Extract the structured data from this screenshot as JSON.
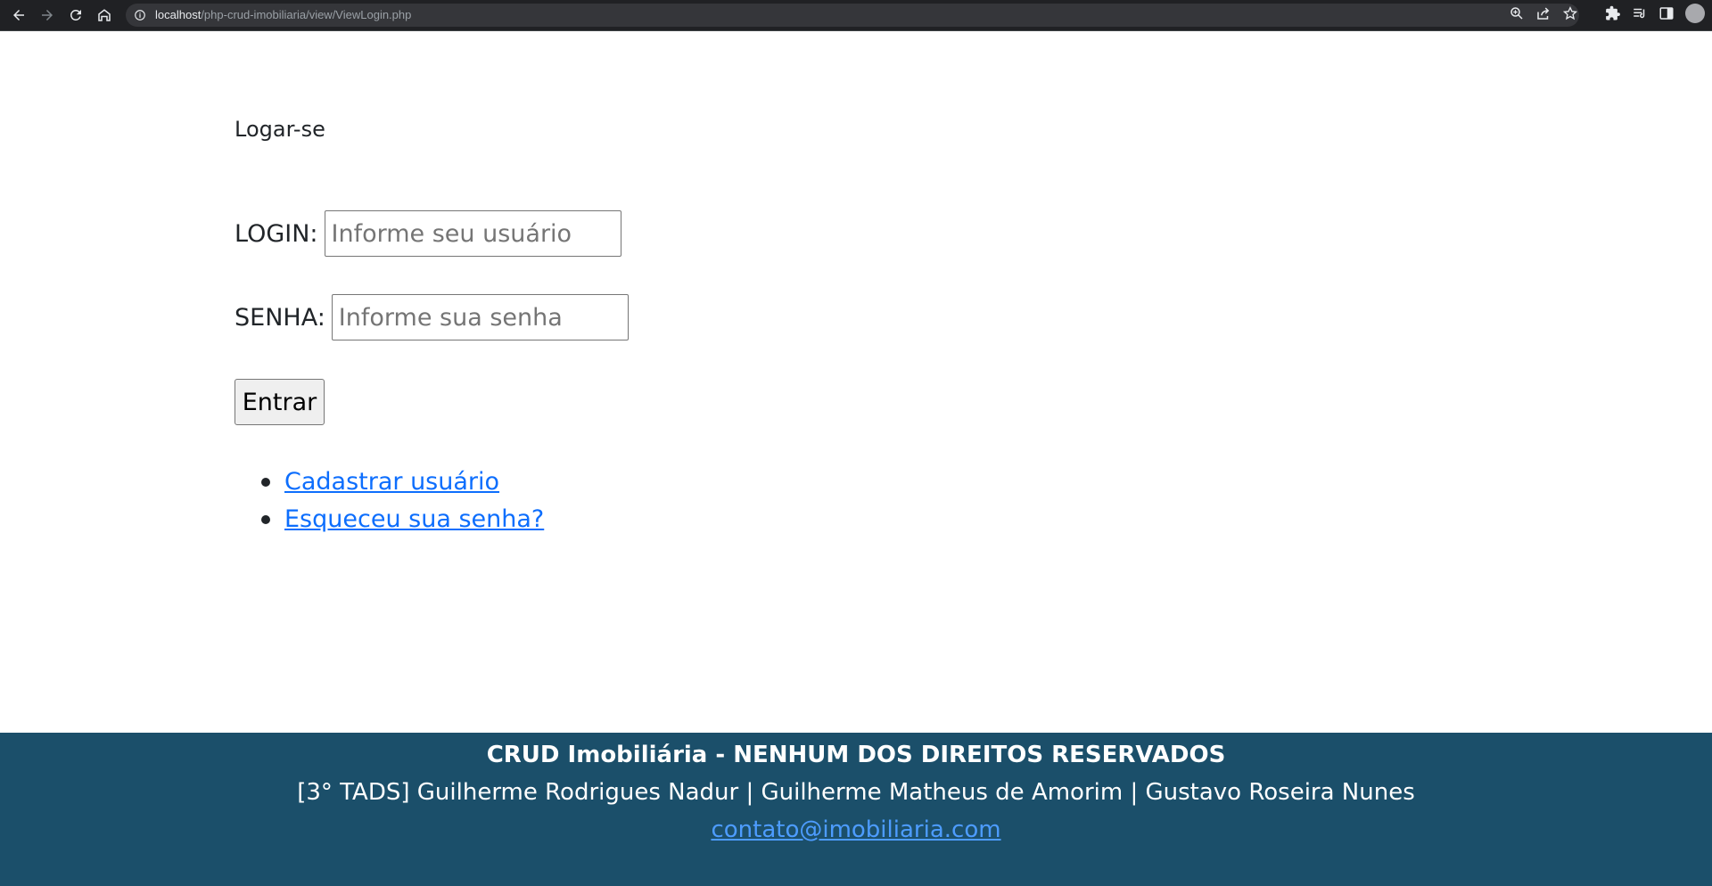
{
  "browser": {
    "url_host": "localhost",
    "url_path": "/php-crud-imobiliaria/view/ViewLogin.php",
    "icons": [
      "back-icon",
      "forward-icon",
      "reload-icon",
      "home-icon",
      "info-icon",
      "zoom-icon",
      "share-icon",
      "star-icon",
      "extensions-icon",
      "reading-list-icon",
      "side-panel-icon",
      "profile-avatar"
    ]
  },
  "page": {
    "title": "Logar-se"
  },
  "form": {
    "login_label": "LOGIN:",
    "login_placeholder": "Informe seu usuário",
    "login_value": "",
    "senha_label": "SENHA:",
    "senha_placeholder": "Informe sua senha",
    "senha_value": "",
    "submit_label": "Entrar"
  },
  "links": [
    {
      "label": "Cadastrar usuário"
    },
    {
      "label": "Esqueceu sua senha?"
    }
  ],
  "footer": {
    "title": "CRUD Imobiliária - NENHUM DOS DIREITOS RESERVADOS",
    "authors": "[3° TADS] Guilherme Rodrigues Nadur | Guilherme Matheus de Amorim | Gustavo Roseira Nunes",
    "email": "contato@imobiliaria.com"
  },
  "colors": {
    "footer_bg": "#1b4f6a",
    "link": "#0d6efd",
    "chrome_bg": "#202124"
  }
}
